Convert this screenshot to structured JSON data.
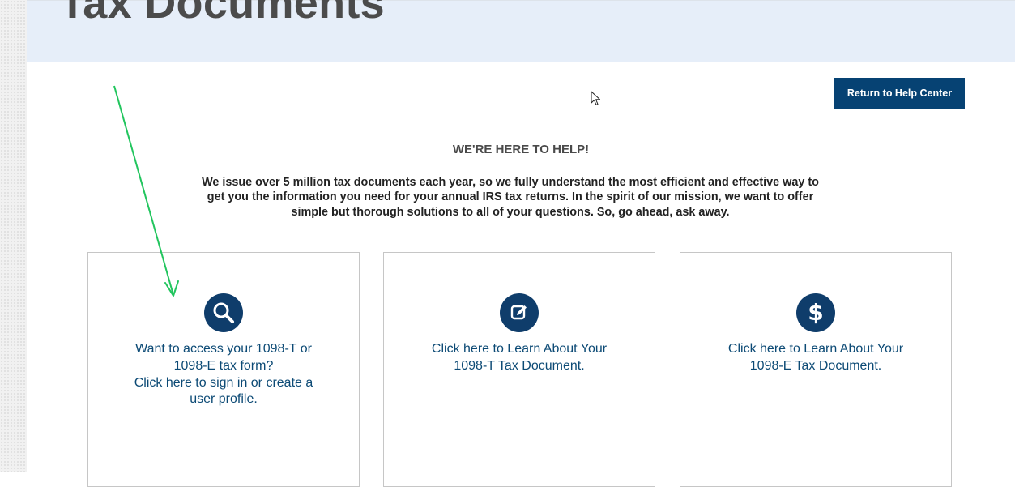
{
  "page": {
    "title": "Tax Documents"
  },
  "header": {
    "return_button_label": "Return to Help Center"
  },
  "help": {
    "heading": "WE'RE HERE TO HELP!",
    "body": "We issue over 5 million tax documents each year, so we fully understand the most efficient and effective way to get you the information you need for your annual IRS tax returns. In the spirit of our mission, we want to offer simple but thorough solutions to all of your questions. So, go ahead, ask away."
  },
  "cards": [
    {
      "icon": "magnifier-icon",
      "text": "Want to access your 1098-T or\n1098-E tax form?\nClick here to sign in or create a\nuser profile."
    },
    {
      "icon": "edit-document-icon",
      "text": "Click here to Learn About Your\n1098-T Tax Document."
    },
    {
      "icon": "dollar-icon",
      "text": "Click here to Learn About Your\n1098-E Tax Document."
    }
  ],
  "colors": {
    "brand_navy": "#064273",
    "icon_circle": "#0f3d6b",
    "card_text": "#0c4a75",
    "banner_bg": "#e6eef9",
    "annotation_arrow": "#22c55e"
  }
}
